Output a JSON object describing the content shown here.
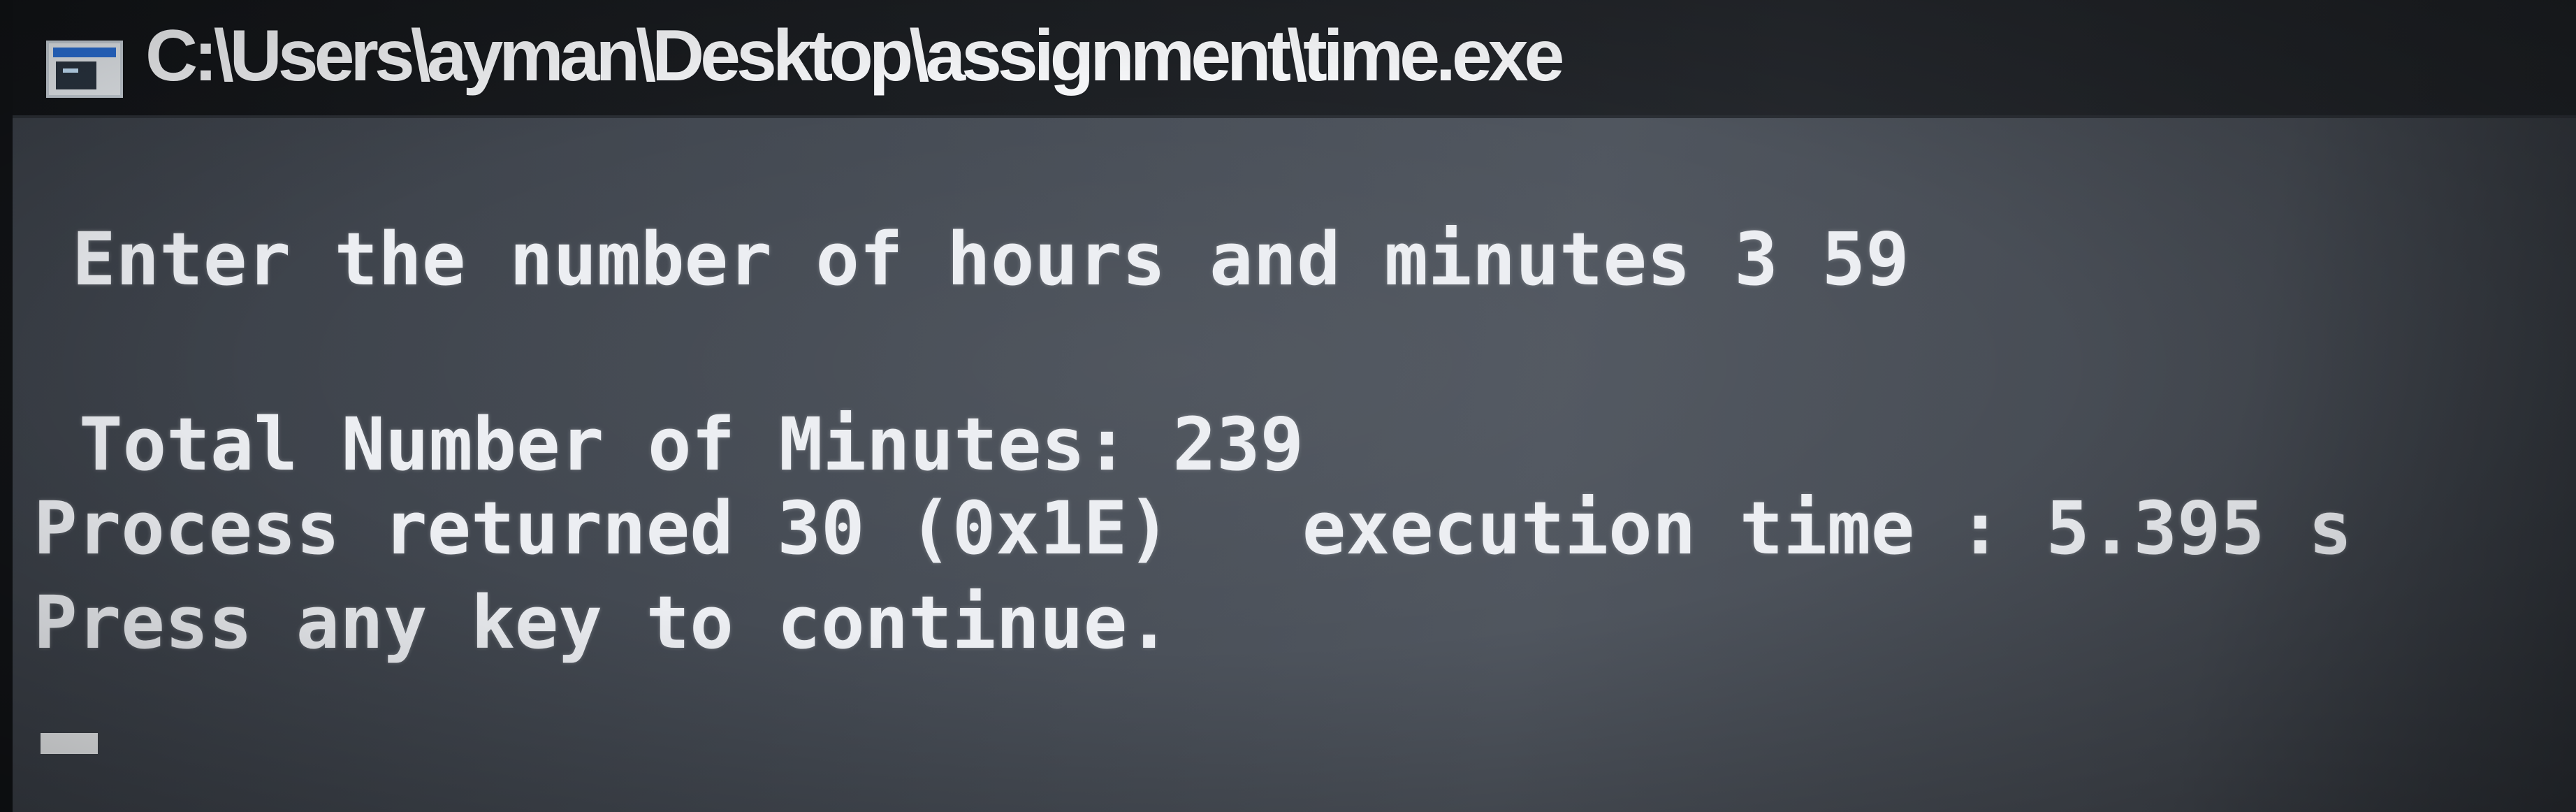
{
  "window": {
    "title": "C:\\Users\\ayman\\Desktop\\assignment\\time.exe",
    "icon": "console-app-icon"
  },
  "console": {
    "lines": [
      "Enter the number of hours and minutes 3 59",
      "Total Number of Minutes: 239",
      "Process returned 30 (0x1E)   execution time : 5.395 s",
      "Press any key to continue."
    ]
  },
  "colors": {
    "background": "#464c55",
    "text": "#eceef2",
    "titlebar": "#1c1f23"
  }
}
